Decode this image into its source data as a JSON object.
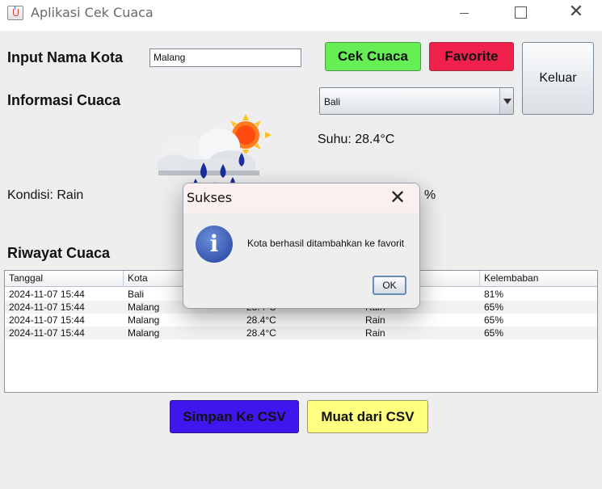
{
  "window": {
    "title": "Aplikasi Cek Cuaca",
    "icon": "java-cup-icon"
  },
  "form": {
    "city_label": "Input Nama Kota",
    "city_value": "Malang",
    "info_label": "Informasi Cuaca",
    "selected_city": "Bali"
  },
  "buttons": {
    "cek": "Cek Cuaca",
    "favorite": "Favorite",
    "exit": "Keluar",
    "save_csv": "Simpan Ke CSV",
    "load_csv": "Muat dari CSV"
  },
  "weather": {
    "temperature": "Suhu: 28.4°C",
    "condition": "Kondisi: Rain",
    "humidity_fragment": "%",
    "icon": "rain-cloud-sun-icon"
  },
  "history": {
    "title": "Riwayat Cuaca",
    "columns": [
      "Tanggal",
      "Kota",
      "",
      "",
      "Kelembaban"
    ],
    "rows": [
      [
        "2024-11-07 15:44",
        "Bali",
        "",
        "",
        "81%"
      ],
      [
        "2024-11-07 15:44",
        "Malang",
        "28.4°C",
        "Rain",
        "65%"
      ],
      [
        "2024-11-07 15:44",
        "Malang",
        "28.4°C",
        "Rain",
        "65%"
      ],
      [
        "2024-11-07 15:44",
        "Malang",
        "28.4°C",
        "Rain",
        "65%"
      ]
    ]
  },
  "dialog": {
    "title": "Sukses",
    "message": "Kota berhasil ditambahkan ke favorit",
    "ok": "OK",
    "icon": "info-icon"
  },
  "colors": {
    "cek_button": "#66ee55",
    "favorite_button": "#f0204c",
    "save_csv_button": "#3f17ee",
    "load_csv_button": "#ffff80"
  }
}
